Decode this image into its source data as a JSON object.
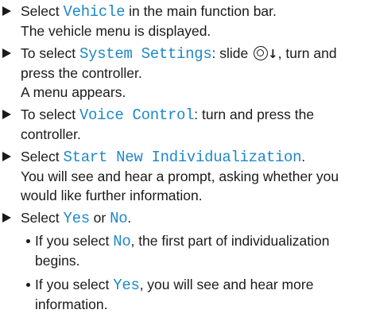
{
  "steps": [
    {
      "t1": "Select ",
      "ui1": "Vehicle",
      "t2": " in the main function bar.",
      "result": "The vehicle menu is displayed."
    },
    {
      "t1": "To select ",
      "ui1": "System Settings",
      "t2": ": slide ",
      "icon": "controller-slide-down-icon",
      "arrow": "↓",
      "t3": ", turn and press the controller.",
      "result": "A menu appears."
    },
    {
      "t1": "To select ",
      "ui1": "Voice Control",
      "t2": ": turn and press the controller."
    },
    {
      "t1": "Select ",
      "ui1": "Start New Individualization",
      "t2": ".",
      "result": "You will see and hear a prompt, asking whether you would like further information."
    },
    {
      "t1": "Select ",
      "ui1": "Yes",
      "t2": " or ",
      "ui2": "No",
      "t3": "."
    }
  ],
  "sub_items": [
    {
      "t1": "If you select ",
      "ui": "No",
      "t2": ", the first part of individual­ization begins."
    },
    {
      "t1": "If you select ",
      "ui": "Yes",
      "t2": ", you will see and hear more information."
    }
  ],
  "colors": {
    "ui_text": "#1e88c8",
    "body_text": "#1a1a1a"
  }
}
